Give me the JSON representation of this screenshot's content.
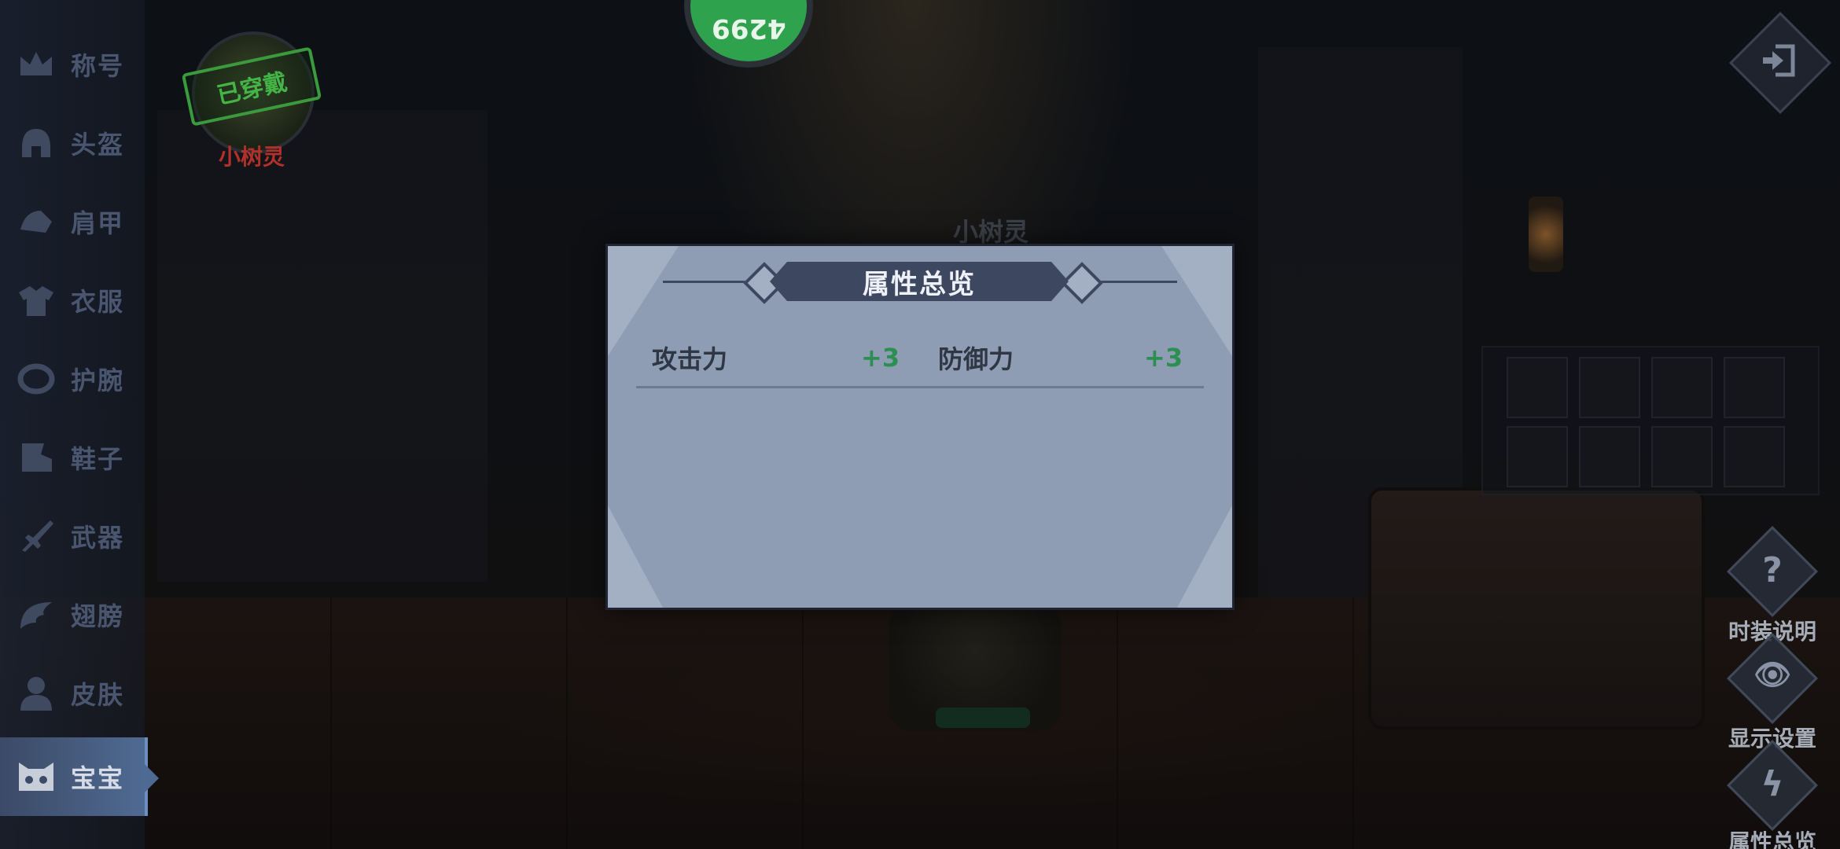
{
  "sidebar": {
    "items": [
      {
        "label": "称号",
        "icon": "crown-icon"
      },
      {
        "label": "头盔",
        "icon": "helmet-icon"
      },
      {
        "label": "肩甲",
        "icon": "shoulder-armor-icon"
      },
      {
        "label": "衣服",
        "icon": "shirt-icon"
      },
      {
        "label": "护腕",
        "icon": "bracer-icon"
      },
      {
        "label": "鞋子",
        "icon": "boots-icon"
      },
      {
        "label": "武器",
        "icon": "sword-icon"
      },
      {
        "label": "翅膀",
        "icon": "wing-icon"
      },
      {
        "label": "皮肤",
        "icon": "person-icon"
      },
      {
        "label": "宝宝",
        "icon": "pet-icon",
        "active": true
      }
    ]
  },
  "equipped": {
    "stamp": "已穿戴",
    "name": "小树灵"
  },
  "score_ball": {
    "value": "4299"
  },
  "stage": {
    "character_name": "小树灵"
  },
  "modal": {
    "title": "属性总览",
    "stats": [
      {
        "name": "攻击力",
        "value": "+3"
      },
      {
        "name": "防御力",
        "value": "+3"
      }
    ]
  },
  "actions": [
    {
      "label": "时装说明",
      "icon": "question-icon",
      "glyph": "?"
    },
    {
      "label": "显示设置",
      "icon": "eye-icon",
      "glyph": "👁"
    },
    {
      "label": "属性总览",
      "icon": "attribute-icon",
      "glyph": "ϟ"
    }
  ],
  "colors": {
    "accent_green": "#2c8f52",
    "modal_bg": "#8f9db4",
    "title_bar": "#3e4760",
    "active_tab": "#4f6a92",
    "equipped_red": "#b0302a"
  }
}
